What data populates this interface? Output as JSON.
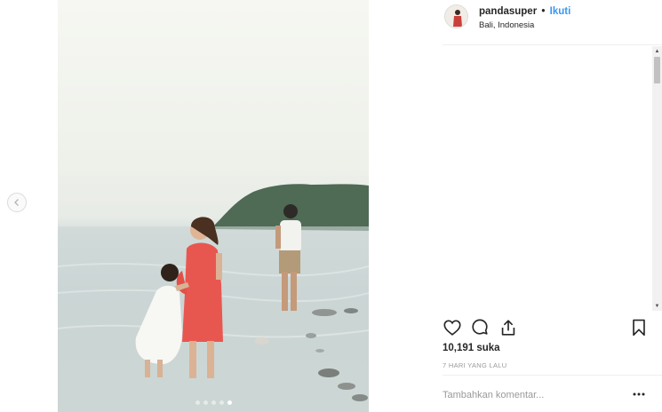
{
  "post": {
    "username": "pandasuper",
    "separator": "•",
    "follow_label": "Ikuti",
    "location": "Bali, Indonesia",
    "likes_text": "10,191 suka",
    "time_text": "7 HARI YANG LALU",
    "comment_placeholder": "Tambahkan komentar...",
    "carousel": {
      "slide_count": 5,
      "active_index": 4
    }
  },
  "icons": {
    "prev": "chevron-left-icon",
    "like": "heart-icon",
    "comment": "comment-icon",
    "share": "share-icon",
    "save": "bookmark-icon",
    "more": "more-options-icon"
  },
  "colors": {
    "follow_blue": "#3897f0",
    "text": "#262626",
    "muted": "#999999",
    "divider": "#efefef",
    "dress_red": "#e8574f"
  }
}
